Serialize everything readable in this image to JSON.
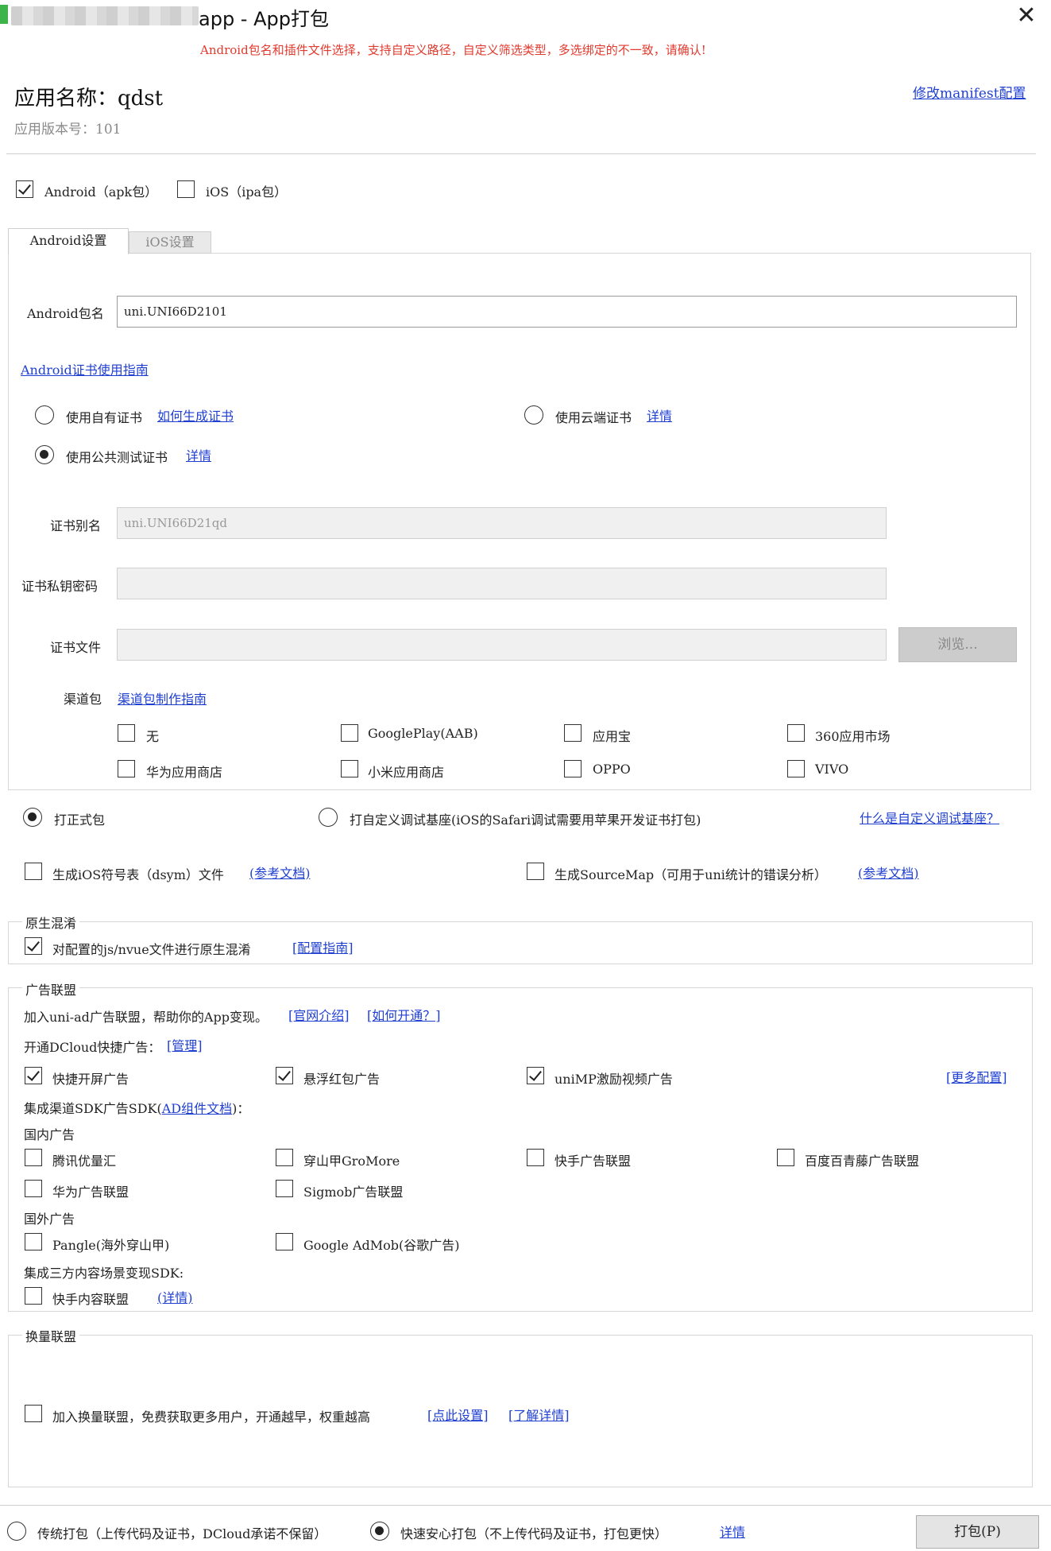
{
  "window": {
    "title": "app - App打包",
    "close_glyph": "✕"
  },
  "warning": "Android包名和插件文件选择，支持自定义路径，自定义筛选类型，多选绑定的不一致，请确认!",
  "app": {
    "name_label": "应用名称：qdst",
    "version_label": "应用版本号：101",
    "manifest_link": "修改manifest配置"
  },
  "platforms": {
    "android": {
      "label": "Android（apk包）",
      "checked": true
    },
    "ios": {
      "label": "iOS（ipa包）",
      "checked": false
    }
  },
  "tabs": [
    {
      "label": "Android设置",
      "active": true
    },
    {
      "label": "iOS设置",
      "active": false
    }
  ],
  "android": {
    "package_label": "Android包名",
    "package_value": "uni.UNI66D2101",
    "cert_guide_link": "Android证书使用指南",
    "cert_options": {
      "own": {
        "label": "使用自有证书",
        "link": "如何生成证书",
        "checked": false
      },
      "cloud": {
        "label": "使用云端证书",
        "link": "详情",
        "checked": false
      },
      "public": {
        "label": "使用公共测试证书",
        "link": "详情",
        "checked": true
      }
    },
    "alias_label": "证书别名",
    "alias_value": "uni.UNI66D21qd",
    "password_label": "证书私钥密码",
    "password_value": "",
    "file_label": "证书文件",
    "file_value": "",
    "browse_label": "浏览...",
    "channel_label": "渠道包",
    "channel_link": "渠道包制作指南",
    "channels": [
      {
        "label": "无",
        "checked": false
      },
      {
        "label": "GooglePlay(AAB)",
        "checked": false
      },
      {
        "label": "应用宝",
        "checked": false
      },
      {
        "label": "360应用市场",
        "checked": false
      },
      {
        "label": "华为应用商店",
        "checked": false
      },
      {
        "label": "小米应用商店",
        "checked": false
      },
      {
        "label": "OPPO",
        "checked": false
      },
      {
        "label": "VIVO",
        "checked": false
      }
    ]
  },
  "build_type": {
    "release": {
      "label": "打正式包",
      "checked": true
    },
    "custom_base": {
      "label": "打自定义调试基座(iOS的Safari调试需要用苹果开发证书打包)",
      "checked": false
    },
    "help_link": "什么是自定义调试基座？"
  },
  "dsym": {
    "label": "生成iOS符号表（dsym）文件",
    "link": "(参考文档)",
    "checked": false
  },
  "sourcemap": {
    "label": "生成SourceMap（可用于uni统计的错误分析）",
    "link": "(参考文档)",
    "checked": false
  },
  "obfuscation": {
    "title": "原生混淆",
    "label": "对配置的js/nvue文件进行原生混淆",
    "link": "[配置指南]",
    "checked": true
  },
  "ads": {
    "title": "广告联盟",
    "intro": "加入uni-ad广告联盟，帮助你的App变现。",
    "intro_link1": "[官网介绍]",
    "intro_link2": "[如何开通？]",
    "quick_label": "开通DCloud快捷广告：",
    "quick_link": "[管理]",
    "quick_items": [
      {
        "label": "快捷开屏广告",
        "checked": true
      },
      {
        "label": "悬浮红包广告",
        "checked": true
      },
      {
        "label": "uniMP激励视频广告",
        "checked": true
      }
    ],
    "more_link": "[更多配置]",
    "sdk_label_prefix": "集成渠道SDK广告SDK(",
    "sdk_link": "AD组件文档",
    "sdk_label_suffix": ")：",
    "domestic_title": "国内广告",
    "domestic": [
      {
        "label": "腾讯优量汇",
        "checked": false
      },
      {
        "label": "穿山甲GroMore",
        "checked": false
      },
      {
        "label": "快手广告联盟",
        "checked": false
      },
      {
        "label": "百度百青藤广告联盟",
        "checked": false
      },
      {
        "label": "华为广告联盟",
        "checked": false
      },
      {
        "label": "Sigmob广告联盟",
        "checked": false
      }
    ],
    "foreign_title": "国外广告",
    "foreign": [
      {
        "label": "Pangle(海外穿山甲)",
        "checked": false
      },
      {
        "label": "Google AdMob(谷歌广告)",
        "checked": false
      }
    ],
    "content_title": "集成三方内容场景变现SDK:",
    "content": {
      "label": "快手内容联盟",
      "link": "(详情)",
      "checked": false
    }
  },
  "exchange": {
    "title": "换量联盟",
    "label": "加入换量联盟，免费获取更多用户，开通越早，权重越高",
    "link1": "[点此设置]",
    "link2": "[了解详情]",
    "checked": false
  },
  "footer": {
    "traditional": {
      "label": "传统打包（上传代码及证书，DCloud承诺不保留）",
      "checked": false
    },
    "fast": {
      "label": "快速安心打包（不上传代码及证书，打包更快）",
      "checked": true
    },
    "detail_link": "详情",
    "pack_button": "打包(P)"
  }
}
